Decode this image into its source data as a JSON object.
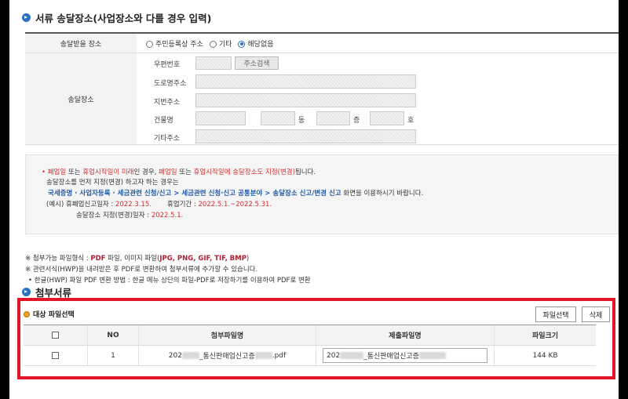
{
  "section1": {
    "title": "서류 송달장소(사업장소와 다를 경우 입력)"
  },
  "delivery": {
    "header": "송달받을 장소",
    "options": [
      "주민등록상 주소",
      "기타",
      "해당없음"
    ],
    "selected_index": 2
  },
  "address": {
    "header": "송달장소",
    "zip_label": "우편번호",
    "search_button": "주소검색",
    "road_label": "도로명주소",
    "lot_label": "지번주소",
    "building_label": "건물명",
    "dong": "동",
    "floor": "층",
    "ho": "호",
    "other_label": "기타주소"
  },
  "notice": {
    "l1": {
      "bullet": "•",
      "a": "폐업일",
      "b": " 또는 ",
      "c": "휴업시작일이 미래",
      "d": "인 경우, ",
      "e": "폐업일",
      "f": " 또는 ",
      "g": "휴업시작일에 송달장소도 지정(변경)",
      "h": "됩니다."
    },
    "l2": "송달장소를 먼저 지정(변경) 하고자 하는 경우는",
    "l3": {
      "path": "국세증명 · 사업자등록 · 세금관련 신청/신고 > 세금관련 신청·신고 공통분야 > 송달장소 신고/변경 신고",
      "rest": " 화면을 이용하시기 바랍니다."
    },
    "l4": {
      "a": "(예시) 휴폐업신고일자 : ",
      "b": "2022.3.15.",
      "c": "휴업기간 : ",
      "d": "2022.5.1.~2022.5.31."
    },
    "l5": {
      "a": "송달장소 지정(변경)일자 : ",
      "b": "2022.5.1."
    }
  },
  "notes": {
    "n1": {
      "a": "※ 첨부가능 파일형식 : ",
      "b": "PDF",
      "c": " 파일, 이미지 파일(",
      "d": "JPG, PNG, GIF, TIF, BMP",
      "e": ")"
    },
    "n2": "※ 관련서식(HWP)을 내려받은 후 PDF로 변환하여 첨부서류에 추가할 수 있습니다.",
    "n3": "• 한글(HWP) 파일 PDF 변환 방법 : 한글 메뉴 상단의 파일-PDF로 저장하기를 이용하여 PDF로 변환"
  },
  "section2": {
    "title": "첨부서류"
  },
  "files": {
    "target_label": "대상 파일선택",
    "select_button": "파일선택",
    "delete_button": "삭제",
    "columns": [
      "NO",
      "첨부파일명",
      "제출파일명",
      "파일크기"
    ],
    "rows": [
      {
        "no": "1",
        "attach_prefix": "202",
        "attach_mid": "_통신판매업신고증",
        "attach_ext": ".pdf",
        "submit_prefix": "202",
        "submit_mid": "_통신판매업신고증",
        "size": "144 KB"
      }
    ]
  },
  "colors": {
    "accent": "#2a6fc2",
    "highlight_box": "#e3152a",
    "emphasis": "#d03030"
  }
}
